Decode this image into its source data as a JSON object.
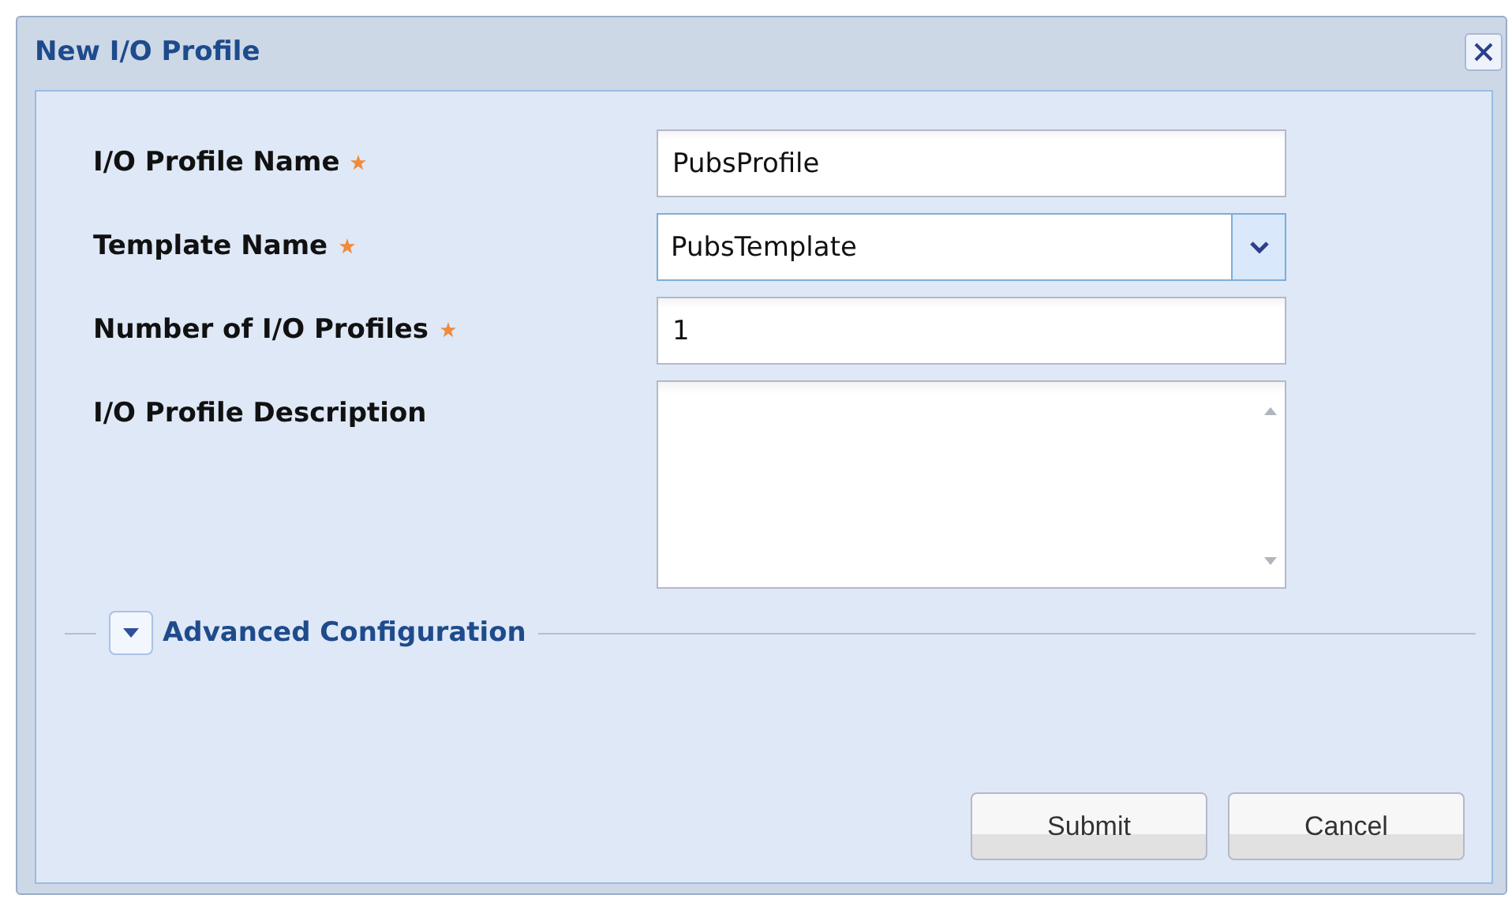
{
  "window": {
    "title": "New I/O Profile"
  },
  "fields": [
    {
      "kind": "text",
      "label": "I/O Profile Name",
      "required": true,
      "value": "PubsProfile"
    },
    {
      "kind": "combo",
      "label": "Template Name",
      "required": true,
      "value": "PubsTemplate"
    },
    {
      "kind": "text",
      "label": "Number of I/O Profiles",
      "required": true,
      "value": "1"
    },
    {
      "kind": "textarea",
      "label": "I/O Profile Description",
      "required": false
    }
  ],
  "advanced": {
    "label": "Advanced Configuration",
    "expanded": false
  },
  "buttons": [
    "Submit",
    "Cancel"
  ]
}
